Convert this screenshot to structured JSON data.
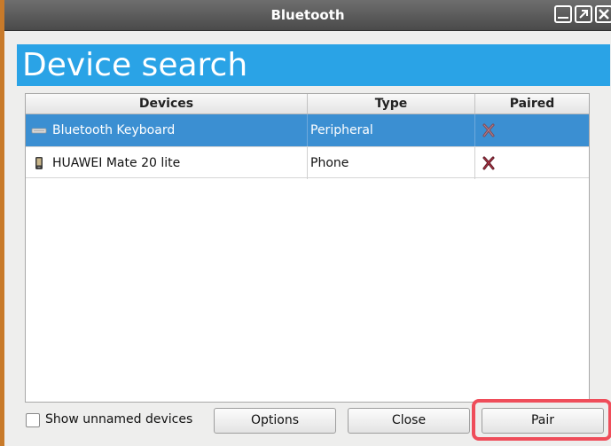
{
  "window": {
    "title": "Bluetooth"
  },
  "header": {
    "title": "Device search",
    "accent_color": "#2aa3e6"
  },
  "table": {
    "columns": [
      "Devices",
      "Type",
      "Paired"
    ],
    "rows": [
      {
        "device": "Bluetooth Keyboard",
        "type": "Peripheral",
        "paired": "not-paired",
        "icon": "keyboard-icon",
        "selected": true
      },
      {
        "device": "HUAWEI Mate 20 lite",
        "type": "Phone",
        "paired": "not-paired",
        "icon": "phone-icon",
        "selected": false
      }
    ],
    "selection_color": "#3b8fd2"
  },
  "footer": {
    "show_unnamed_label": "Show unnamed devices",
    "show_unnamed_checked": false,
    "options_label": "Options",
    "close_label": "Close",
    "pair_label": "Pair",
    "highlight_color": "#ef4d5a"
  }
}
